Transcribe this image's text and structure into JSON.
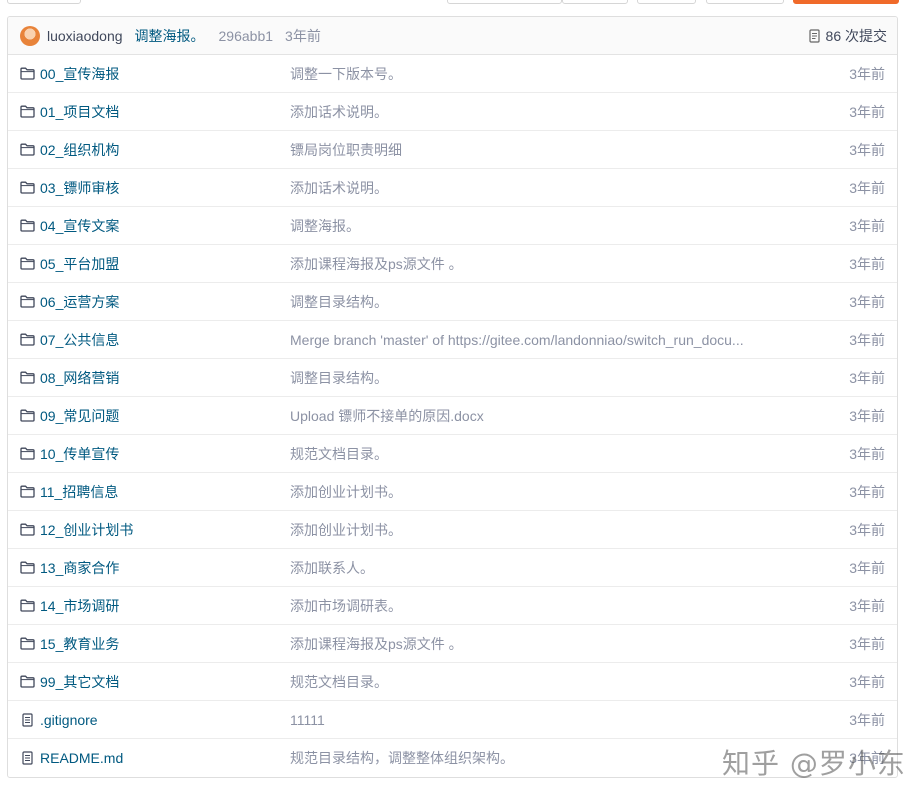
{
  "latest_commit": {
    "author": "luoxiaodong",
    "message": "调整海报。",
    "sha": "296abb1",
    "time": "3年前",
    "commits_count_label": "86 次提交"
  },
  "files": [
    {
      "type": "folder",
      "name": "00_宣传海报",
      "message": "调整一下版本号。",
      "time": "3年前"
    },
    {
      "type": "folder",
      "name": "01_项目文档",
      "message": "添加话术说明。",
      "time": "3年前"
    },
    {
      "type": "folder",
      "name": "02_组织机构",
      "message": "镖局岗位职责明细",
      "time": "3年前"
    },
    {
      "type": "folder",
      "name": "03_镖师审核",
      "message": "添加话术说明。",
      "time": "3年前"
    },
    {
      "type": "folder",
      "name": "04_宣传文案",
      "message": "调整海报。",
      "time": "3年前"
    },
    {
      "type": "folder",
      "name": "05_平台加盟",
      "message": "添加课程海报及ps源文件 。",
      "time": "3年前"
    },
    {
      "type": "folder",
      "name": "06_运营方案",
      "message": "调整目录结构。",
      "time": "3年前"
    },
    {
      "type": "folder",
      "name": "07_公共信息",
      "message": "Merge branch 'master' of https://gitee.com/landonniao/switch_run_docu...",
      "time": "3年前"
    },
    {
      "type": "folder",
      "name": "08_网络营销",
      "message": "调整目录结构。",
      "time": "3年前"
    },
    {
      "type": "folder",
      "name": "09_常见问题",
      "message": "Upload 镖师不接单的原因.docx",
      "time": "3年前"
    },
    {
      "type": "folder",
      "name": "10_传单宣传",
      "message": "规范文档目录。",
      "time": "3年前"
    },
    {
      "type": "folder",
      "name": "11_招聘信息",
      "message": "添加创业计划书。",
      "time": "3年前"
    },
    {
      "type": "folder",
      "name": "12_创业计划书",
      "message": "添加创业计划书。",
      "time": "3年前"
    },
    {
      "type": "folder",
      "name": "13_商家合作",
      "message": "添加联系人。",
      "time": "3年前"
    },
    {
      "type": "folder",
      "name": "14_市场调研",
      "message": "添加市场调研表。",
      "time": "3年前"
    },
    {
      "type": "folder",
      "name": "15_教育业务",
      "message": "添加课程海报及ps源文件 。",
      "time": "3年前"
    },
    {
      "type": "folder",
      "name": "99_其它文档",
      "message": "规范文档目录。",
      "time": "3年前"
    },
    {
      "type": "file",
      "name": ".gitignore",
      "message": "11111",
      "time": "3年前"
    },
    {
      "type": "file",
      "name": "README.md",
      "message": "规范目录结构，调整整体组织架构。",
      "time": "3年前"
    }
  ],
  "watermark": "知乎 @罗小东",
  "icons": {
    "folder": "folder-icon",
    "file": "file-icon",
    "commits": "commit-history-icon"
  },
  "colors": {
    "link": "#005980",
    "muted": "#8c92a4",
    "accent": "#f06a2a"
  }
}
